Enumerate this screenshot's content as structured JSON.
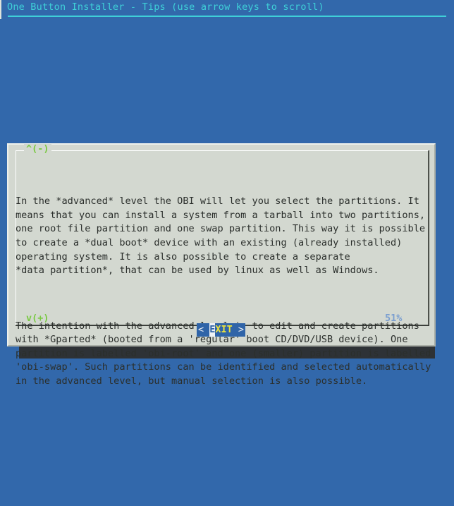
{
  "window": {
    "title": "One Button Installer - Tips (use arrow keys to scroll)"
  },
  "colors": {
    "desktop_background": "#3268ab",
    "title_text": "#3fd0d8",
    "dialog_background": "#d3d8d0",
    "body_text": "#2b2f2c",
    "scroll_marker": "#7ac943",
    "percent_text": "#7b9fd0",
    "button_background": "#2f64a8",
    "button_label": "#ede33c",
    "button_hotkey_background": "#eef2f6",
    "shadow": "#2e3236"
  },
  "dialog": {
    "scroll_up_indicator": "^(-)",
    "scroll_down_indicator": "v(+)",
    "scroll_percent": "51%",
    "paragraphs": [
      "In the *advanced* level the OBI will let you select the partitions. It\nmeans that you can install a system from a tarball into two partitions,\none root file partition and one swap partition. This way it is possible\nto create a *dual boot* device with an existing (already installed)\noperating system. It is also possible to create a separate\n*data partition*, that can be used by linux as well as Windows.",
      "The intention with the advanced level is to edit and create partitions\nwith *Gparted* (booted from a 'regular' boot CD/DVD/USB device). One\npartition is labelled 'obi-root' and one (smaller) partition is labelled\n'obi-swap'. Such partitions can be identified and selected automatically\nin the advanced level, but manual selection is also possible."
    ],
    "button": {
      "left_bracket": "< ",
      "hotkey": "E",
      "rest": "XIT",
      "right_bracket": " >"
    }
  }
}
